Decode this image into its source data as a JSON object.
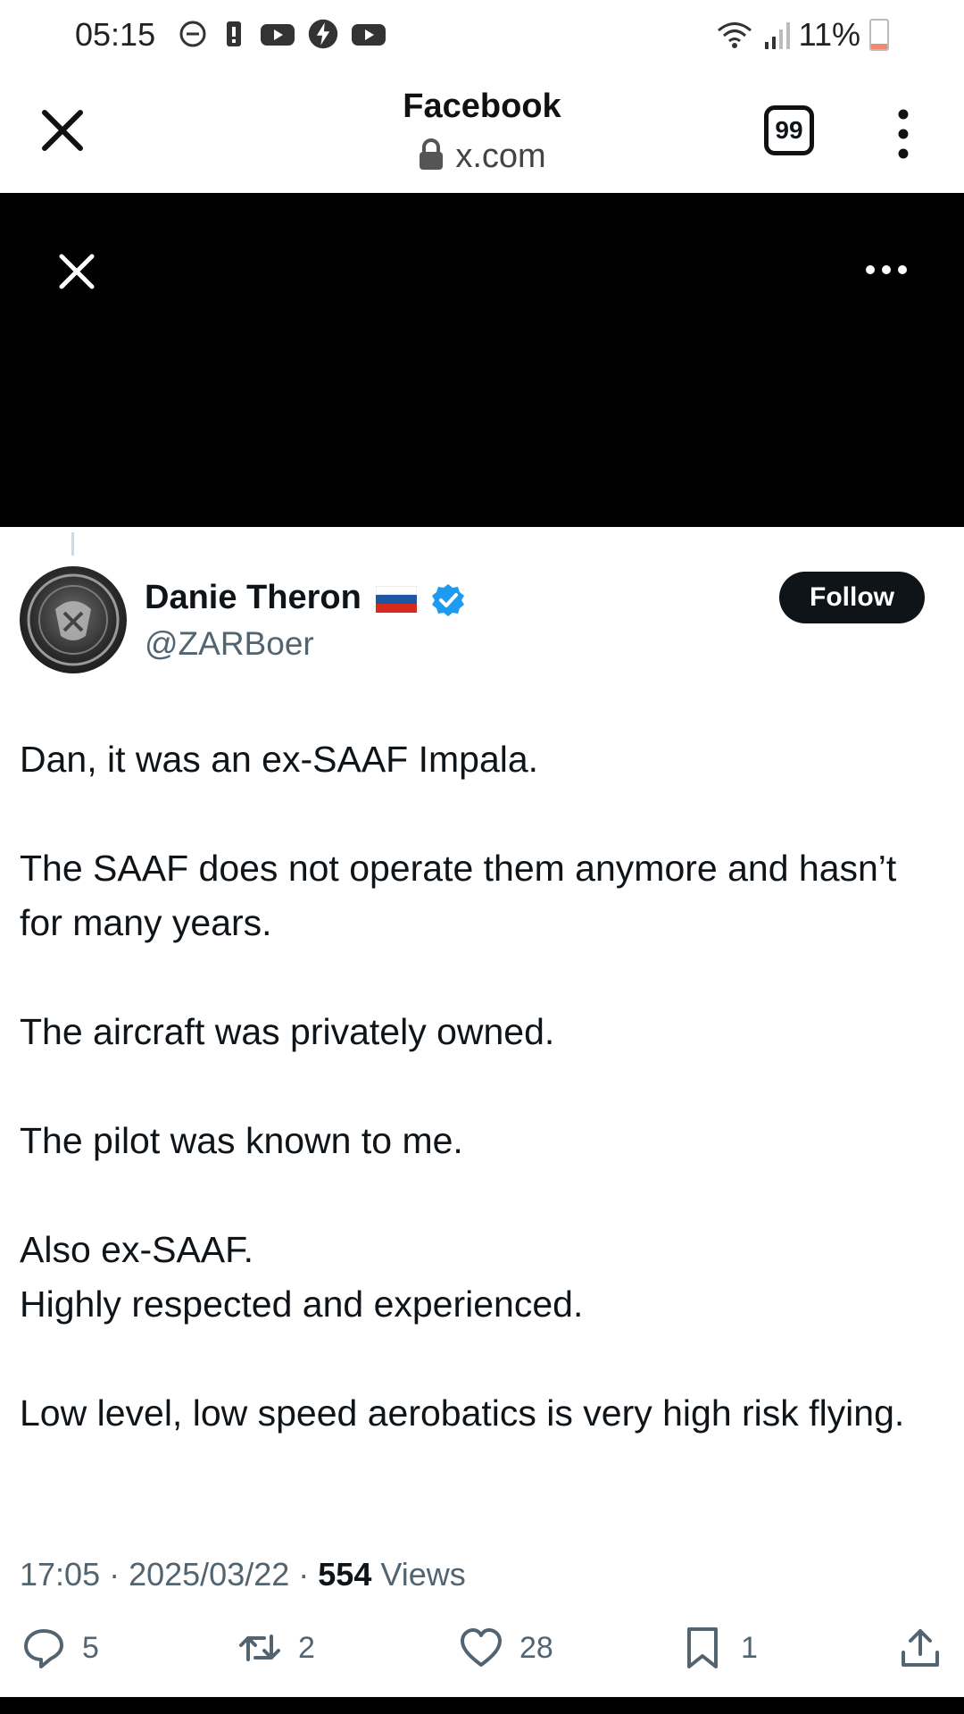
{
  "status_bar": {
    "time": "05:15",
    "battery": "11%",
    "icons": [
      "do-not-disturb-icon",
      "battery-alert-icon",
      "youtube-icon",
      "bolt-icon",
      "youtube-icon",
      "wifi-icon",
      "signal-icon"
    ]
  },
  "browser": {
    "title": "Facebook",
    "url": "x.com",
    "tab_count": "99"
  },
  "tweet": {
    "display_name": "Danie Theron",
    "handle": "@ZARBoer",
    "follow_label": "Follow",
    "paragraphs": [
      "Dan, it was an ex-SAAF Impala.",
      "The SAAF does not operate them anymore and hasn’t for many years.",
      "The aircraft was privately owned.",
      "The pilot was known to me.",
      "Also ex-SAAF.\nHighly respected and experienced.",
      "Low level, low speed aerobatics is very high risk flying."
    ],
    "time": "17:05",
    "date": "2025/03/22",
    "views_count": "554",
    "views_label": "Views",
    "replies": "5",
    "reposts": "2",
    "likes": "28",
    "bookmarks": "1"
  },
  "colors": {
    "verified": "#1d9bf0",
    "follow_bg": "#0f1419",
    "secondary_text": "#536471"
  }
}
